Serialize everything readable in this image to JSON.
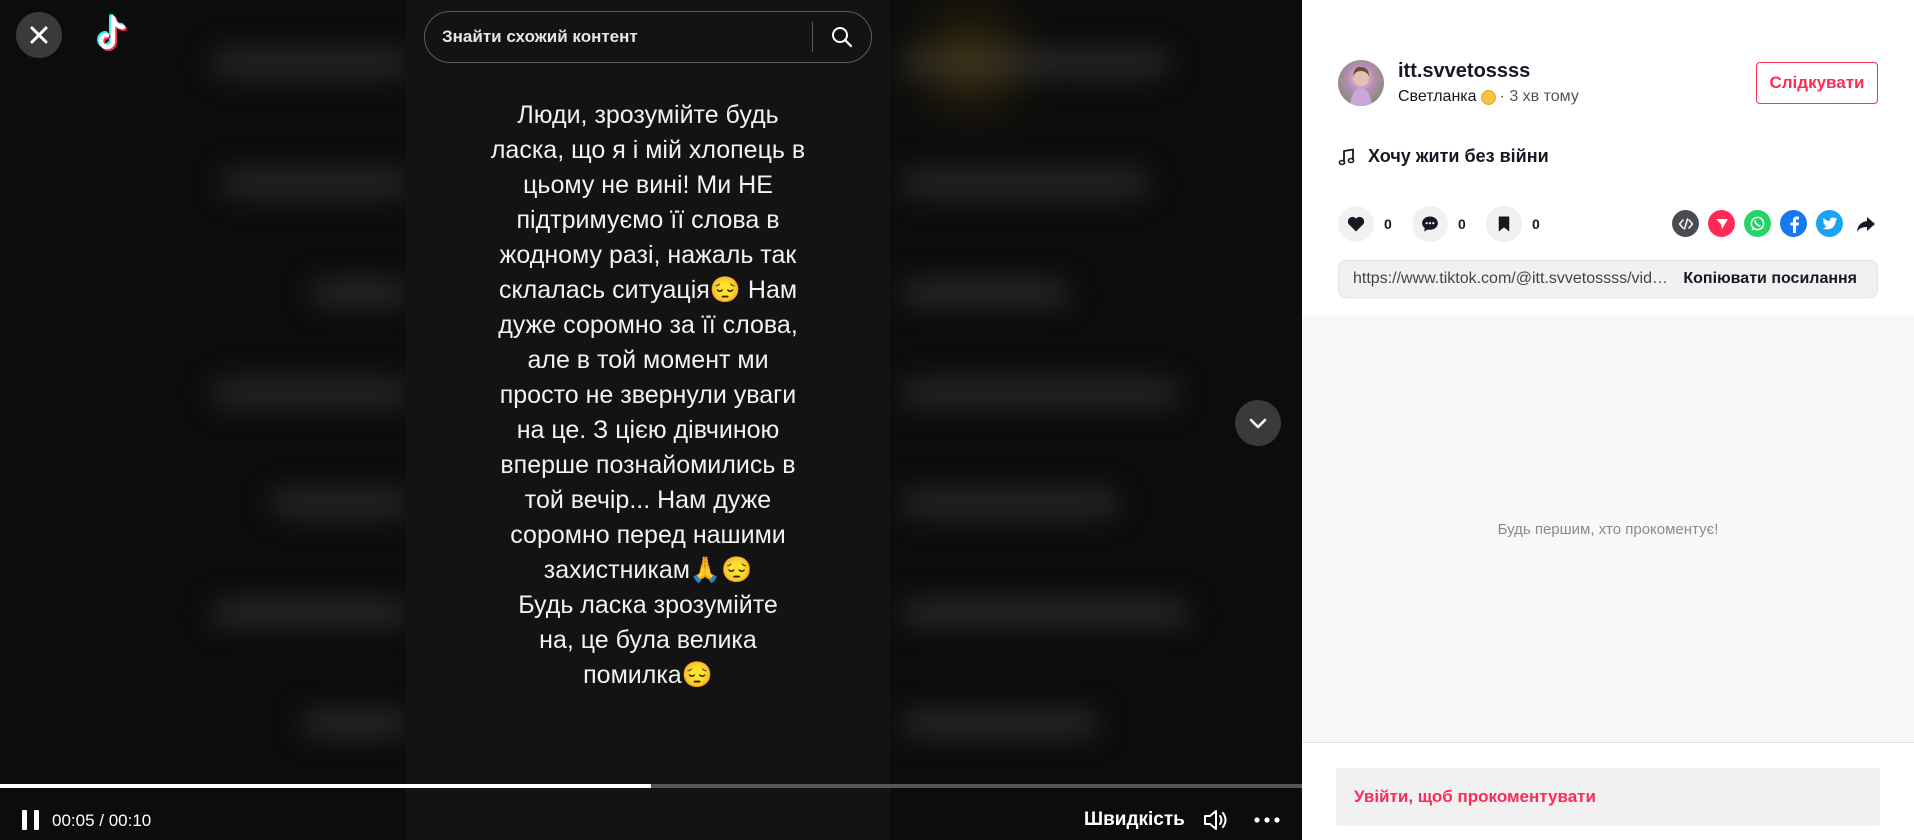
{
  "search": {
    "placeholder": "Знайти схожий контент"
  },
  "video": {
    "overlay_text": "Люди, зрозумійте будь\nласка, що я і мій хлопець в\nцьому не вині! Ми НЕ\nпідтримуємо її слова в\nжодному разі, нажаль так\nсклалась ситуація😔 Нам\nдуже соромно за її слова,\nале в той момент ми\nпросто не звернули уваги\nна це. З цією дівчиною\nвперше познайомились в\nтой вечір... Нам дуже\nсоромно перед нашими\nзахистникам🙏😔\nБудь ласка зрозумійте\nна, це була велика\nпомилка😔",
    "progress": 0.5,
    "time": "00:05 / 00:10",
    "speed_label": "Швидкість"
  },
  "author": {
    "username": "itt.svvetossss",
    "nickname": "Светланка",
    "posted": "· 3 хв тому",
    "follow_label": "Слідкувати"
  },
  "music": {
    "title": "Хочу жити без війни"
  },
  "stats": {
    "likes": "0",
    "comments": "0",
    "saves": "0"
  },
  "share": {
    "icons": [
      "embed-icon",
      "send-icon",
      "whatsapp-icon",
      "facebook-icon",
      "twitter-icon",
      "share-arrow-icon"
    ],
    "colors": {
      "embed": "#4b4b52",
      "send": "#fe2c55",
      "whatsapp": "#25d366",
      "facebook": "#1877f2",
      "twitter": "#1da1f2"
    }
  },
  "link": {
    "url": "https://www.tiktok.com/@itt.svvetossss/video/7153097562381782278",
    "copy_label": "Копіювати посилання"
  },
  "comments": {
    "empty_text": "Будь першим, хто прокоментує!",
    "login_label": "Увійти, щоб прокоментувати"
  },
  "colors": {
    "brand_red": "#fe2c55",
    "panel_bg": "#ffffff",
    "video_bg": "#0c0c0c"
  }
}
